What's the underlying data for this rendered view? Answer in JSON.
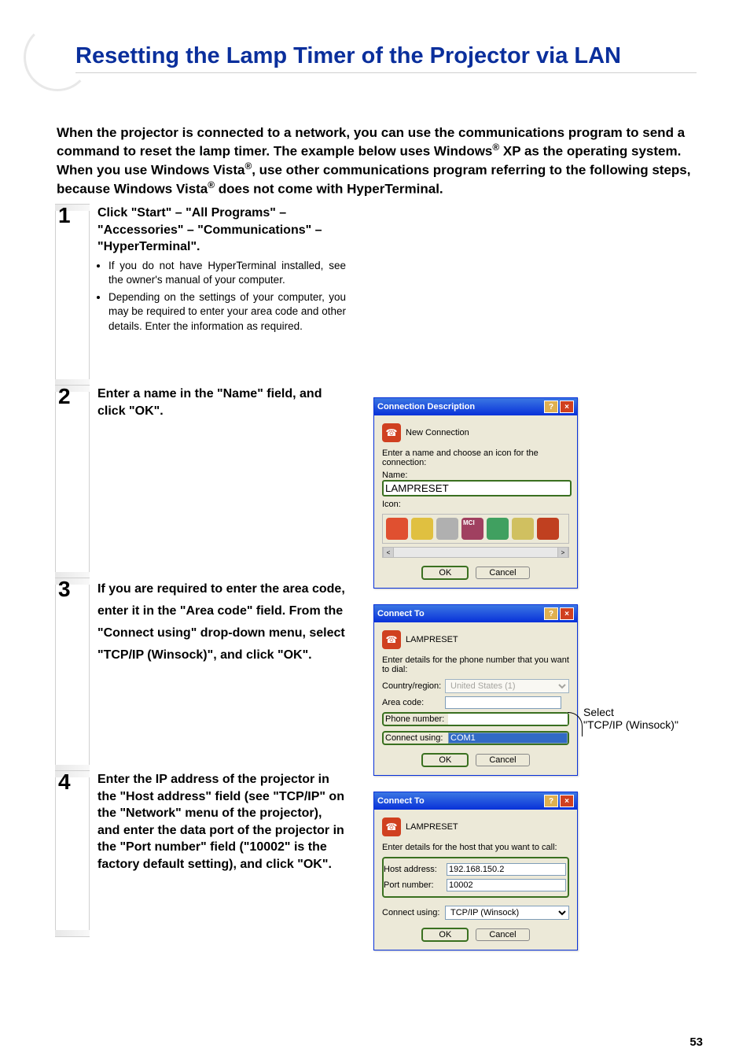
{
  "title": "Resetting the Lamp Timer of the Projector via LAN",
  "intro_parts": {
    "p1": "When the projector is connected to a network, you can use the communications program to send a command to reset the lamp timer. The example below uses Windows",
    "reg1": "®",
    "p2": " XP as the operating system. When you use Windows Vista",
    "reg2": "®",
    "p3": ", use other communications program referring to the following steps, because Windows Vista",
    "reg3": "®",
    "p4": " does not come with HyperTerminal."
  },
  "steps": [
    {
      "num": "1",
      "bold": "Click \"Start\" – \"All Programs\" – \"Accessories\" – \"Communications\" – \"HyperTerminal\".",
      "bullets": [
        "If you do not have HyperTerminal installed, see the owner's manual of your computer.",
        "Depending on the settings of your computer, you may be required to enter your area code and other details. Enter the information as required."
      ]
    },
    {
      "num": "2",
      "bold": "Enter a name in the \"Name\" field, and click \"OK\"."
    },
    {
      "num": "3",
      "bold": "If you are required to enter the area code, enter it in the \"Area code\" field. From the \"Connect using\" drop-down menu, select \"TCP/IP (Winsock)\", and click \"OK\"."
    },
    {
      "num": "4",
      "bold": "Enter the IP address of the projector in the \"Host address\" field (see \"TCP/IP\" on the \"Network\" menu of the projector), and enter the data port of the projector in the \"Port number\" field (\"10002\" is the factory default setting), and click \"OK\"."
    }
  ],
  "dlg1": {
    "title": "Connection Description",
    "header": "New Connection",
    "prompt": "Enter a name and choose an icon for the connection:",
    "name_label": "Name:",
    "name_value": "LAMPRESET",
    "icon_label": "Icon:",
    "ok": "OK",
    "cancel": "Cancel"
  },
  "dlg2": {
    "title": "Connect To",
    "header": "LAMPRESET",
    "prompt": "Enter details for the phone number that you want to dial:",
    "country_label": "Country/region:",
    "country_value": "United States (1)",
    "area_label": "Area code:",
    "phone_label": "Phone number:",
    "connect_label": "Connect using:",
    "connect_value": "COM1",
    "ok": "OK",
    "cancel": "Cancel"
  },
  "dlg3": {
    "title": "Connect To",
    "header": "LAMPRESET",
    "prompt": "Enter details for the host that you want to call:",
    "host_label": "Host address:",
    "host_value": "192.168.150.2",
    "port_label": "Port number:",
    "port_value": "10002",
    "connect_label": "Connect using:",
    "connect_value": "TCP/IP (Winsock)",
    "ok": "OK",
    "cancel": "Cancel"
  },
  "annotation": {
    "line1": "Select",
    "line2": "\"TCP/IP (Winsock)\""
  },
  "page_number": "53"
}
